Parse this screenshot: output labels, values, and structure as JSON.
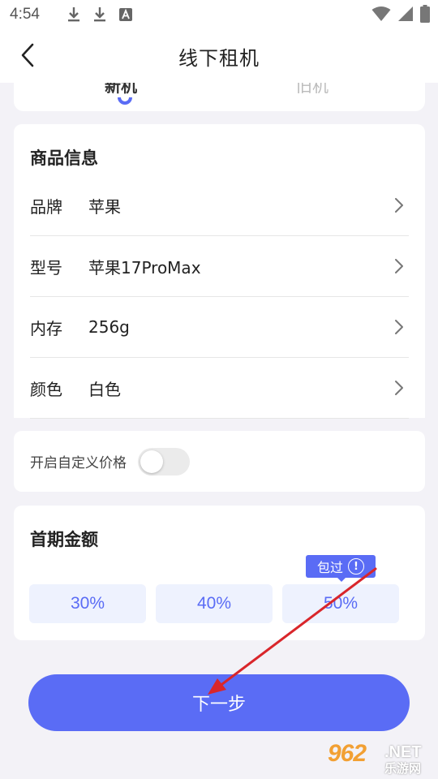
{
  "status_bar": {
    "time": "4:54",
    "icons": [
      "download-icon",
      "download-icon",
      "a-icon",
      "wifi-icon",
      "signal-icon",
      "battery-icon"
    ]
  },
  "nav": {
    "title": "线下租机",
    "back_icon": "chevron-left-icon"
  },
  "tabs": [
    {
      "label": "新机",
      "active": true
    },
    {
      "label": "旧机",
      "active": false
    }
  ],
  "product_info": {
    "title": "商品信息",
    "rows": [
      {
        "label": "品牌",
        "value": "苹果"
      },
      {
        "label": "型号",
        "value": "苹果17ProMax"
      },
      {
        "label": "内存",
        "value": "256g"
      },
      {
        "label": "颜色",
        "value": "白色"
      }
    ]
  },
  "custom_price": {
    "label": "开启自定义价格",
    "enabled": false
  },
  "down_payment": {
    "title": "首期金额",
    "options": [
      "30%",
      "40%",
      "50%"
    ],
    "badge": "包过",
    "badge_icon": "!"
  },
  "next_button": "下一步",
  "watermark": {
    "brand": "962",
    "suffix": ".NET",
    "cn": "乐游网"
  },
  "colors": {
    "accent": "#5a6cf5",
    "option_bg": "#eef2fe",
    "page_bg": "#f3f2f7",
    "annotation_arrow": "#d9262b"
  }
}
